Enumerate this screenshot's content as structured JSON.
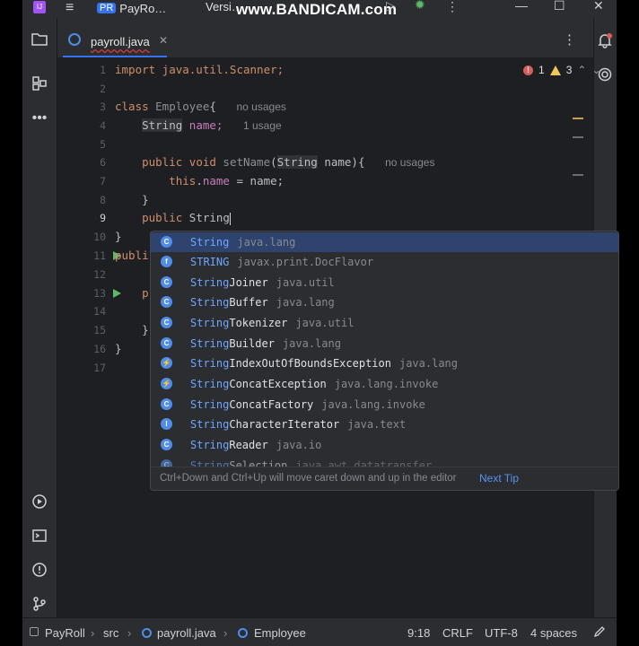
{
  "titlebar": {
    "project_badge": "PR",
    "project_name": "PayRo…",
    "version_label": "Versi…",
    "watermark": "www.BANDICAM.com",
    "logo_text": "IJ"
  },
  "tab": {
    "label": "payroll.java"
  },
  "inspections": {
    "errors": "1",
    "warnings": "3"
  },
  "gutter": [
    "1",
    "2",
    "3",
    "4",
    "5",
    "6",
    "7",
    "8",
    "9",
    "10",
    "11",
    "12",
    "13",
    "14",
    "15",
    "16",
    "17"
  ],
  "code": {
    "l1": "import java.util.Scanner;",
    "l3_kw": "class ",
    "l3_name": "Employee",
    "l3_brace": "{",
    "l3_hint": "no usages",
    "l4_type": "String",
    "l4_field": " name;",
    "l4_hint": "1 usage",
    "l6_kw": "public void ",
    "l6_method": "setName",
    "l6_open": "(",
    "l6_type": "String",
    "l6_rest": " name){",
    "l6_hint": "no usages",
    "l7_kw": "this",
    "l7_dot": ".",
    "l7_field": "name",
    "l7_rest": " = name;",
    "l8": "}",
    "l9_kw": "public ",
    "l9_typed": "String",
    "l10": "}",
    "l11": "publi",
    "l13": "p",
    "l15": "}",
    "l16": "}"
  },
  "completion": {
    "items": [
      {
        "match": "String",
        "rest": "",
        "pkg": "java.lang"
      },
      {
        "match": "STRING",
        "rest": "",
        "pkg": "javax.print.DocFlavor"
      },
      {
        "match": "String",
        "rest": "Joiner",
        "pkg": "java.util"
      },
      {
        "match": "String",
        "rest": "Buffer",
        "pkg": "java.lang"
      },
      {
        "match": "String",
        "rest": "Tokenizer",
        "pkg": "java.util"
      },
      {
        "match": "String",
        "rest": "Builder",
        "pkg": "java.lang"
      },
      {
        "match": "String",
        "rest": "IndexOutOfBoundsException",
        "pkg": "java.lang"
      },
      {
        "match": "String",
        "rest": "ConcatException",
        "pkg": "java.lang.invoke"
      },
      {
        "match": "String",
        "rest": "ConcatFactory",
        "pkg": "java.lang.invoke"
      },
      {
        "match": "String",
        "rest": "CharacterIterator",
        "pkg": "java.text"
      },
      {
        "match": "String",
        "rest": "Reader",
        "pkg": "java.io"
      },
      {
        "match": "String",
        "rest": "Selection",
        "pkg": "java.awt.datatransfer"
      }
    ],
    "tip": "Ctrl+Down and Ctrl+Up will move caret down and up in the editor",
    "next_tip": "Next Tip"
  },
  "statusbar": {
    "project": "PayRoll",
    "folder": "src",
    "file": "payroll.java",
    "class": "Employee",
    "position": "9:18",
    "line_sep": "CRLF",
    "encoding": "UTF-8",
    "indent": "4 spaces"
  },
  "colors": {
    "accent": "#3574f0",
    "error": "#db5c5c",
    "warning": "#f2c55c",
    "run": "#5fb865"
  }
}
